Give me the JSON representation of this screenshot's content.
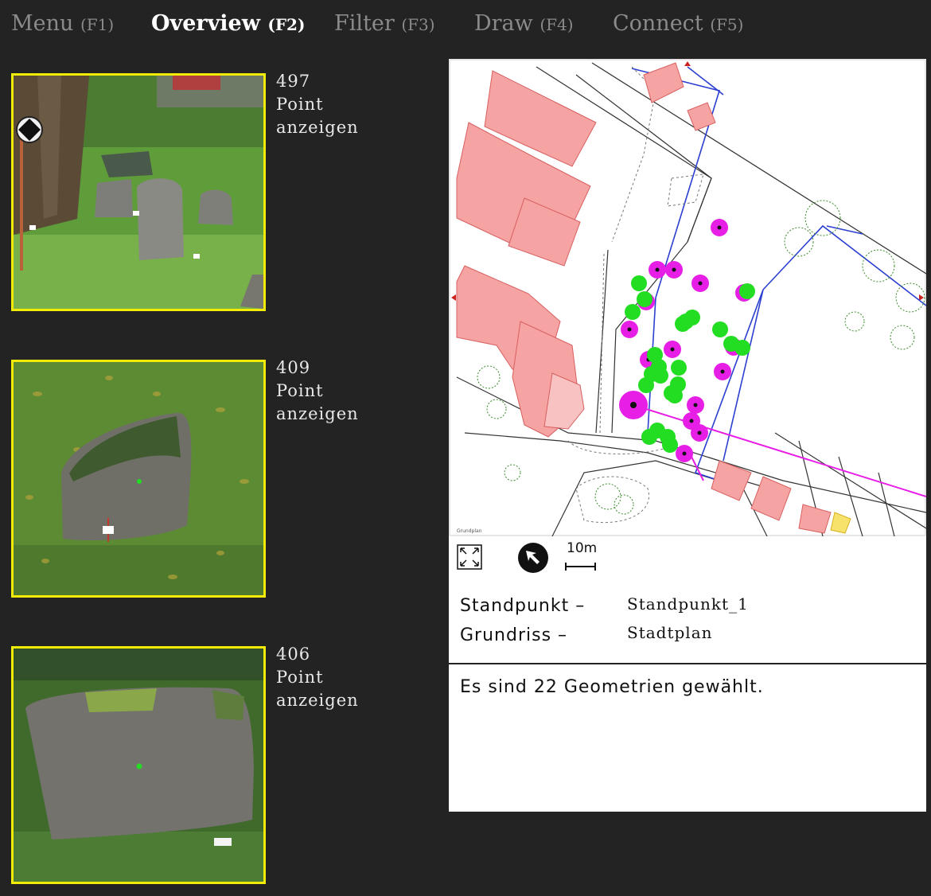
{
  "nav": {
    "items": [
      {
        "label": "Menu",
        "key": "(F1)",
        "active": false
      },
      {
        "label": "Overview",
        "key": "(F2)",
        "active": true
      },
      {
        "label": "Filter",
        "key": "(F3)",
        "active": false
      },
      {
        "label": "Draw",
        "key": "(F4)",
        "active": false
      },
      {
        "label": "Connect",
        "key": "(F5)",
        "active": false
      }
    ]
  },
  "cards": [
    {
      "id": "497",
      "line2": "Point",
      "line3": "anzeigen"
    },
    {
      "id": "409",
      "line2": "Point",
      "line3": "anzeigen"
    },
    {
      "id": "406",
      "line2": "Point",
      "line3": "anzeigen"
    }
  ],
  "map": {
    "scale_label": "10m",
    "icons": [
      "fullscreen-icon",
      "north-arrow-icon",
      "scale-bar-icon"
    ]
  },
  "info": {
    "standpunkt_label": "Standpunkt –",
    "standpunkt_value": "Standpunkt_1",
    "grundriss_label": "Grundriss –",
    "grundriss_value": "Stadtplan"
  },
  "status": "Es sind 22 Geometrien gewählt.",
  "colors": {
    "background": "#232323",
    "thumb_border": "#f2ea07",
    "building": "#f5a3a3",
    "selected_point": "#22dd22",
    "point": "#e61ee6"
  }
}
